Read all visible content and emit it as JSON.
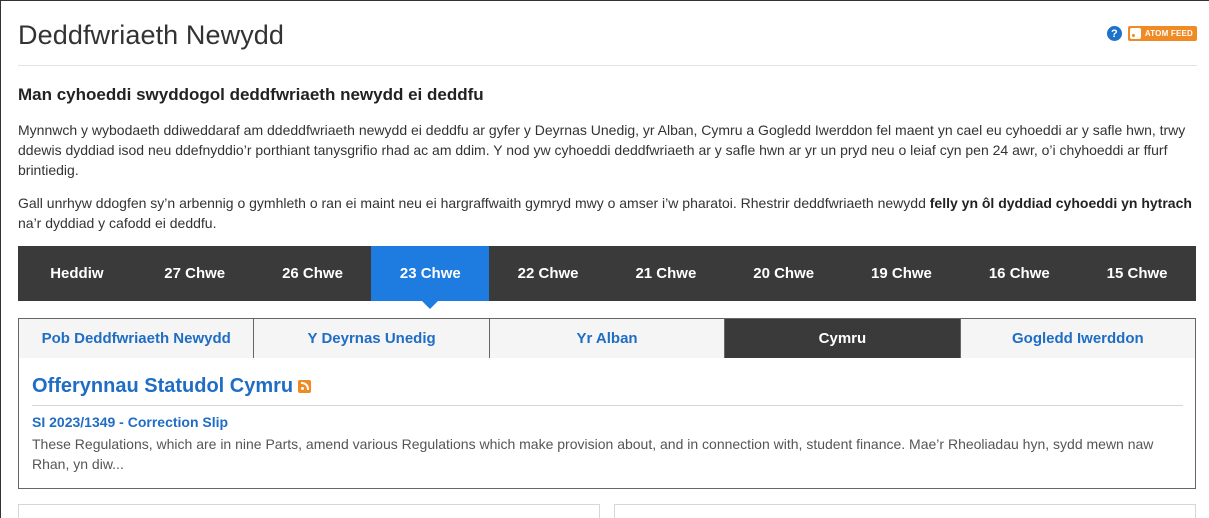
{
  "header": {
    "title": "Deddfwriaeth Newydd",
    "help_icon": "?",
    "atom_feed_label": "ATOM FEED"
  },
  "intro": {
    "heading": "Man cyhoeddi swyddogol deddfwriaeth newydd ei deddfu",
    "paragraph1": "Mynnwch y wybodaeth ddiweddaraf am ddeddfwriaeth newydd ei deddfu ar gyfer y Deyrnas Unedig, yr Alban, Cymru a Gogledd Iwerddon fel maent yn cael eu cyhoeddi ar y safle hwn, trwy ddewis dyddiad isod neu ddefnyddio’r porthiant tanysgrifio rhad ac am ddim. Y nod yw cyhoeddi deddfwriaeth ar y safle hwn ar yr un pryd neu o leiaf cyn pen 24 awr, o’i chyhoeddi ar ffurf brintiedig.",
    "paragraph2_start": "Gall unrhyw ddogfen sy’n arbennig o gymhleth o ran ei maint neu ei hargraffwaith gymryd mwy o amser i’w pharatoi. Rhestrir deddfwriaeth newydd ",
    "paragraph2_bold": "felly yn ôl dyddiad cyhoeddi yn hytrach",
    "paragraph2_end": " na’r dyddiad y cafodd ei deddfu."
  },
  "date_tabs": [
    "Heddiw",
    "27 Chwe",
    "26 Chwe",
    "23 Chwe",
    "22 Chwe",
    "21 Chwe",
    "20 Chwe",
    "19 Chwe",
    "16 Chwe",
    "15 Chwe"
  ],
  "active_date": "23 Chwe",
  "jurisdiction_tabs": [
    "Pob Deddfwriaeth Newydd",
    "Y Deyrnas Unedig",
    "Yr Alban",
    "Cymru",
    "Gogledd Iwerddon"
  ],
  "active_jurisdiction": "Cymru",
  "results": {
    "section_title": "Offerynnau Statudol Cymru",
    "items": [
      {
        "title": "SI 2023/1349 - Correction Slip",
        "description": "These Regulations, which are in nine Parts, amend various Regulations which make provision about, and in connection with, student finance. Mae’r Rheoliadau hyn, sydd mewn naw Rhan, yn diw..."
      }
    ]
  },
  "colors": {
    "accent_blue": "#1e7be0",
    "link_blue": "#1f6dc4",
    "dark_nav": "#3a3a3a",
    "feed_orange": "#f08a24"
  }
}
